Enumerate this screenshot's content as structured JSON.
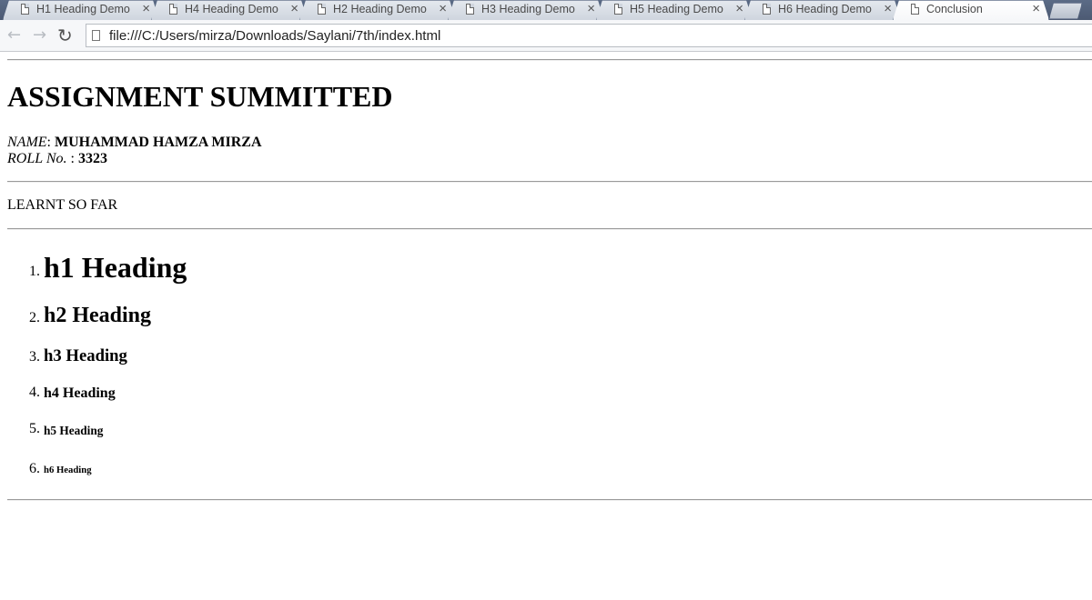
{
  "browser": {
    "tabs": [
      {
        "title": "H1 Heading Demo",
        "close": "×"
      },
      {
        "title": "H4 Heading Demo",
        "close": "×"
      },
      {
        "title": "H2 Heading Demo",
        "close": "×"
      },
      {
        "title": "H3 Heading Demo",
        "close": "×"
      },
      {
        "title": "H5 Heading Demo",
        "close": "×"
      },
      {
        "title": "H6 Heading Demo",
        "close": "×"
      },
      {
        "title": "Conclusion",
        "close": "×"
      }
    ],
    "active_tab": "Conclusion",
    "nav": {
      "back": "←",
      "forward": "→",
      "reload": "↻"
    },
    "address": "file:///C:/Users/mirza/Downloads/Saylani/7th/index.html"
  },
  "page": {
    "title": "ASSIGNMENT SUMMITTED",
    "name_label": "NAME",
    "name_sep": ": ",
    "name_value": "MUHAMMAD HAMZA MIRZA",
    "roll_label": "ROLL No.",
    "roll_sep": " : ",
    "roll_value": "3323",
    "learnt_heading": "LEARNT SO FAR",
    "list": [
      {
        "num": "1.",
        "text": "h1 Heading"
      },
      {
        "num": "2.",
        "text": "h2 Heading"
      },
      {
        "num": "3.",
        "text": "h3 Heading"
      },
      {
        "num": "4.",
        "text": "h4 Heading"
      },
      {
        "num": "5.",
        "text": "h5 Heading"
      },
      {
        "num": "6.",
        "text": "h6 Heading"
      }
    ]
  }
}
